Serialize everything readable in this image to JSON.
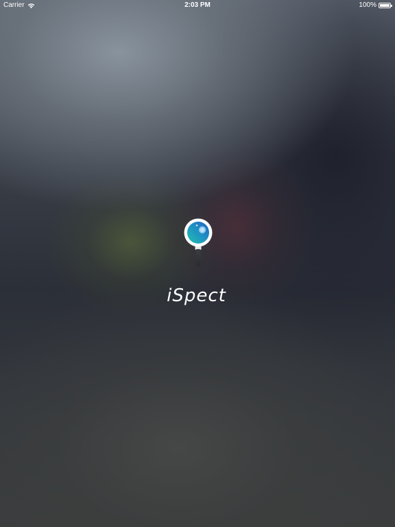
{
  "status_bar": {
    "carrier": "Carrier",
    "time": "2:03 PM",
    "battery_text": "100%",
    "battery_level": 1.0
  },
  "splash": {
    "app_name": "iSpect",
    "icon": "magnifier-lens-icon"
  },
  "colors": {
    "lens_teal": "#1fb0c0",
    "lens_blue": "#2a6fc2",
    "logo_white": "#ffffff"
  }
}
